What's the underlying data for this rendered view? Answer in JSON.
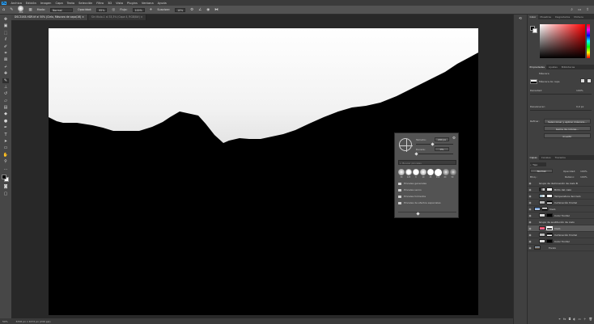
{
  "menu": [
    "Archivo",
    "Edición",
    "Imagen",
    "Capa",
    "Texto",
    "Selección",
    "Filtro",
    "3D",
    "Vista",
    "Plugins",
    "Ventana",
    "Ayuda"
  ],
  "options": {
    "brush_size": "200",
    "mode_label": "Modo:",
    "mode_value": "Normal",
    "opacity_label": "Opacidad:",
    "opacity_value": "95%",
    "flow_label": "Flujo:",
    "flow_value": "100%",
    "smooth_label": "Suavizar:",
    "smooth_value": "10%"
  },
  "tabs": [
    {
      "label": "DSC3163-HDR.tif al 50% (Cielo, Máscara de capa/16)",
      "active": true
    },
    {
      "label": "Sin título-1 al 33,3% (Capa 4, RGB/8#)",
      "active": false
    }
  ],
  "toolbar_icons": [
    "move-icon",
    "artboard-icon",
    "marquee-icon",
    "lasso-icon",
    "quick-select-icon",
    "crop-icon",
    "frame-icon",
    "eyedropper-icon",
    "healing-icon",
    "brush-icon",
    "clone-stamp-icon",
    "history-brush-icon",
    "eraser-icon",
    "gradient-icon",
    "blur-icon",
    "dodge-icon",
    "pen-icon",
    "type-icon",
    "path-select-icon",
    "rectangle-icon",
    "hand-icon",
    "zoom-icon",
    "more-icon"
  ],
  "status": {
    "zoom": "50%",
    "dims": "6706 px x 4472 px (240 ppi)"
  },
  "color_panel": {
    "tabs": [
      "Color",
      "Muestras",
      "Degradados",
      "Motivos"
    ]
  },
  "properties": {
    "tabs": [
      "Propiedades",
      "Ajustes",
      "Bibliotecas"
    ],
    "section": "Máscara",
    "mask_label": "Máscara de capa",
    "density_label": "Densidad:",
    "density_value": "100%",
    "feather_label": "Desvanecer:",
    "feather_value": "0,0 px",
    "refine_label": "Refinar:",
    "select_mask_btn": "Seleccionar y aplicar máscara...",
    "color_range_btn": "Gama de colores...",
    "invert_btn": "Invertir"
  },
  "layers_panel": {
    "tabs": [
      "Capas",
      "Canales",
      "Trazados"
    ],
    "filter_label": "Tipo",
    "blend_mode": "Normal",
    "opacity_label": "Opacidad:",
    "opacity_value": "100%",
    "lock_label": "Bloq.:",
    "fill_label": "Relleno:",
    "fill_value": "100%",
    "layers": [
      {
        "name": "Grupo de iluminación de cielo B",
        "type": "group"
      },
      {
        "name": "Brillo del cielo",
        "type": "adjust"
      },
      {
        "name": "Temperatura del cielo",
        "type": "adjust"
      },
      {
        "name": "Iluminación frontal",
        "type": "adjust"
      },
      {
        "name": "Cielo",
        "type": "sky"
      },
      {
        "name": "Color frontal",
        "type": "adjust"
      },
      {
        "name": "Grupo de sustitución de cielo",
        "type": "group"
      },
      {
        "name": "Cielo",
        "type": "sky",
        "selected": true
      },
      {
        "name": "Iluminación frontal",
        "type": "adjust"
      },
      {
        "name": "Color frontal",
        "type": "adjust"
      },
      {
        "name": "Fondo",
        "type": "photo"
      }
    ]
  },
  "brush_popup": {
    "size_label": "Tamaño:",
    "size_value": "200 px",
    "hardness_label": "Dureza:",
    "hardness_value": "0%",
    "search_placeholder": "Buscar pinceles",
    "tip_sizes": [
      "30",
      "123",
      "8",
      "10",
      "25",
      "112",
      "60",
      "50"
    ],
    "folders": [
      "Pinceles generales",
      "Pinceles secos",
      "Pinceles húmedos",
      "Pinceles de efectos especiales"
    ]
  },
  "colors": {
    "foreground": "#000000",
    "background": "#ffffff",
    "picker_hue": "#ff0000"
  }
}
